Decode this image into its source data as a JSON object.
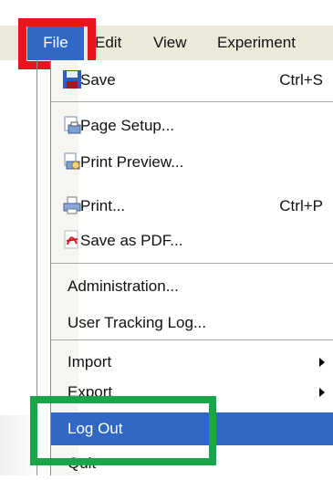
{
  "menubar": {
    "items": [
      "File",
      "Edit",
      "View",
      "Experiment"
    ]
  },
  "file_menu": {
    "save": {
      "label": "Save",
      "shortcut": "Ctrl+S"
    },
    "page_setup": {
      "label": "Page Setup..."
    },
    "print_preview": {
      "label": "Print Preview..."
    },
    "print": {
      "label": "Print...",
      "shortcut": "Ctrl+P"
    },
    "save_as_pdf": {
      "label": "Save as PDF..."
    },
    "administration": {
      "label": "Administration..."
    },
    "user_tracking_log": {
      "label": "User Tracking Log..."
    },
    "import": {
      "label": "Import"
    },
    "export": {
      "label": "Export"
    },
    "log_out": {
      "label": "Log Out"
    },
    "quit": {
      "label": "Quit"
    }
  },
  "colors": {
    "highlight": "#3168c6",
    "red_callout": "#e8151f",
    "green_callout": "#19a64b",
    "menubar_bg": "#ece9d8"
  }
}
